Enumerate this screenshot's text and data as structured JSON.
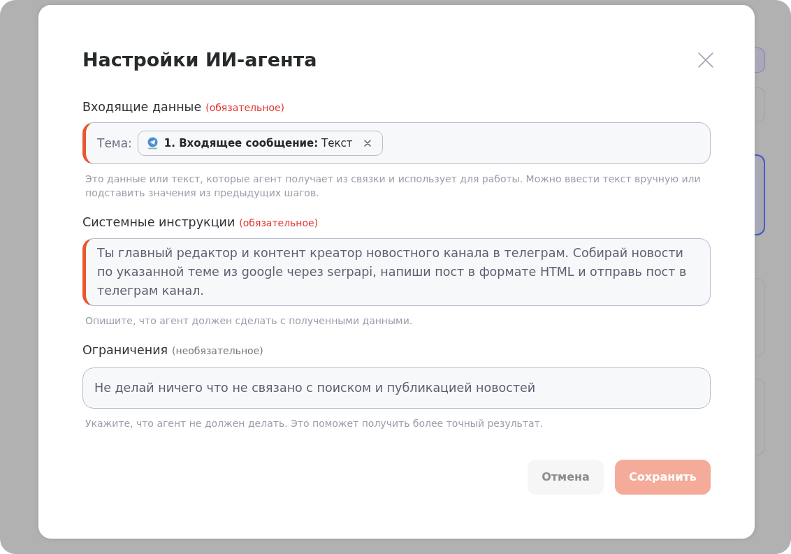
{
  "dialog": {
    "title": "Настройки ИИ-агента"
  },
  "fields": [
    {
      "kind": "variable",
      "label": "Входящие данные",
      "requirement": "(обязательное)",
      "required": true,
      "prefix": "Тема:",
      "tag": "**1. Входящее сообщение:** Текст",
      "hint": "Это данные или текст, которые агент получает из связки и использует для работы. Можно ввести текст вручную или подставить значения из предыдущих шагов."
    },
    {
      "kind": "textarea",
      "label": "Системные инструкции",
      "requirement": "(обязательное)",
      "required": true,
      "value": "Ты главный редактор и контент креатор новостного канала в телеграм. Собирай новости по указанной теме из google через serpapi, напиши пост в формате HTML и отправь пост в телеграм канал.",
      "hint": "Опишите, что агент должен сделать с полученными данными."
    },
    {
      "kind": "input",
      "label": "Ограничения",
      "requirement": "(необязательное)",
      "required": false,
      "value": "Не делай ничего что не связано с поиском и публикацией новостей",
      "hint": "Укажите, что агент не должен делать. Это поможет получить более точный результат."
    }
  ],
  "buttons": [
    {
      "label": "Отмена",
      "kind": "secondary",
      "disabled": false
    },
    {
      "label": "Сохранить",
      "kind": "primary",
      "disabled": true
    }
  ]
}
